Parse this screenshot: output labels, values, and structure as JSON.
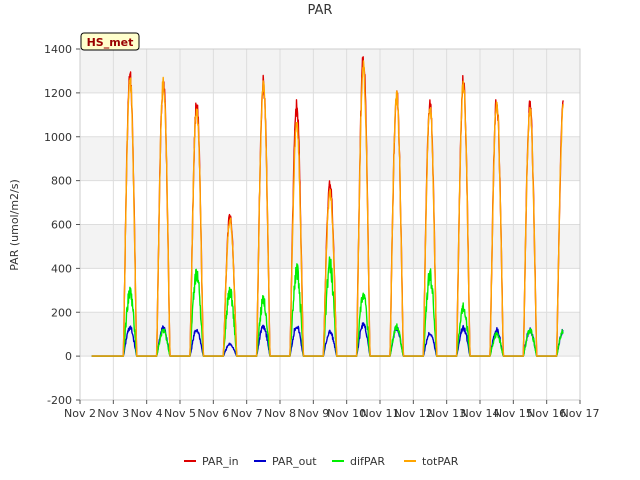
{
  "chart_data": {
    "type": "line",
    "title": "PAR",
    "xlabel": "",
    "ylabel": "PAR (umol/m2/s)",
    "annotation": "HS_met",
    "xlim": [
      "2024-11-02",
      "2024-11-17"
    ],
    "ylim": [
      -200,
      1400
    ],
    "x_tick_labels": [
      "Nov 2",
      "Nov 3",
      "Nov 4",
      "Nov 5",
      "Nov 6",
      "Nov 7",
      "Nov 8",
      "Nov 9",
      "Nov 10",
      "Nov 11",
      "Nov 12",
      "Nov 13",
      "Nov 14",
      "Nov 15",
      "Nov 16",
      "Nov 17"
    ],
    "y_ticks": [
      -200,
      0,
      200,
      400,
      600,
      800,
      1000,
      1200,
      1400
    ],
    "grid": true,
    "legend_position": "bottom",
    "days": [
      "2024-11-02",
      "2024-11-03",
      "2024-11-04",
      "2024-11-05",
      "2024-11-06",
      "2024-11-07",
      "2024-11-08",
      "2024-11-09",
      "2024-11-10",
      "2024-11-11",
      "2024-11-12",
      "2024-11-13",
      "2024-11-14",
      "2024-11-15",
      "2024-11-16"
    ],
    "series": [
      {
        "name": "PAR_in",
        "color": "#dd0000",
        "daily_peak": [
          1310,
          1300,
          1180,
          660,
          1280,
          1170,
          810,
          1390,
          1230,
          1190,
          1290,
          1200,
          1180,
          1180
        ]
      },
      {
        "name": "PAR_out",
        "color": "#0000cc",
        "daily_peak": [
          140,
          140,
          130,
          60,
          150,
          150,
          120,
          160,
          140,
          115,
          140,
          130,
          130,
          130
        ]
      },
      {
        "name": "difPAR",
        "color": "#00ee00",
        "daily_peak": [
          320,
          130,
          420,
          330,
          280,
          430,
          460,
          300,
          150,
          410,
          250,
          110,
          130,
          130
        ]
      },
      {
        "name": "totPAR",
        "color": "#ffa500",
        "daily_peak": [
          1290,
          1280,
          1160,
          640,
          1260,
          1080,
          760,
          1350,
          1210,
          1170,
          1270,
          1180,
          1160,
          1160
        ]
      }
    ]
  }
}
